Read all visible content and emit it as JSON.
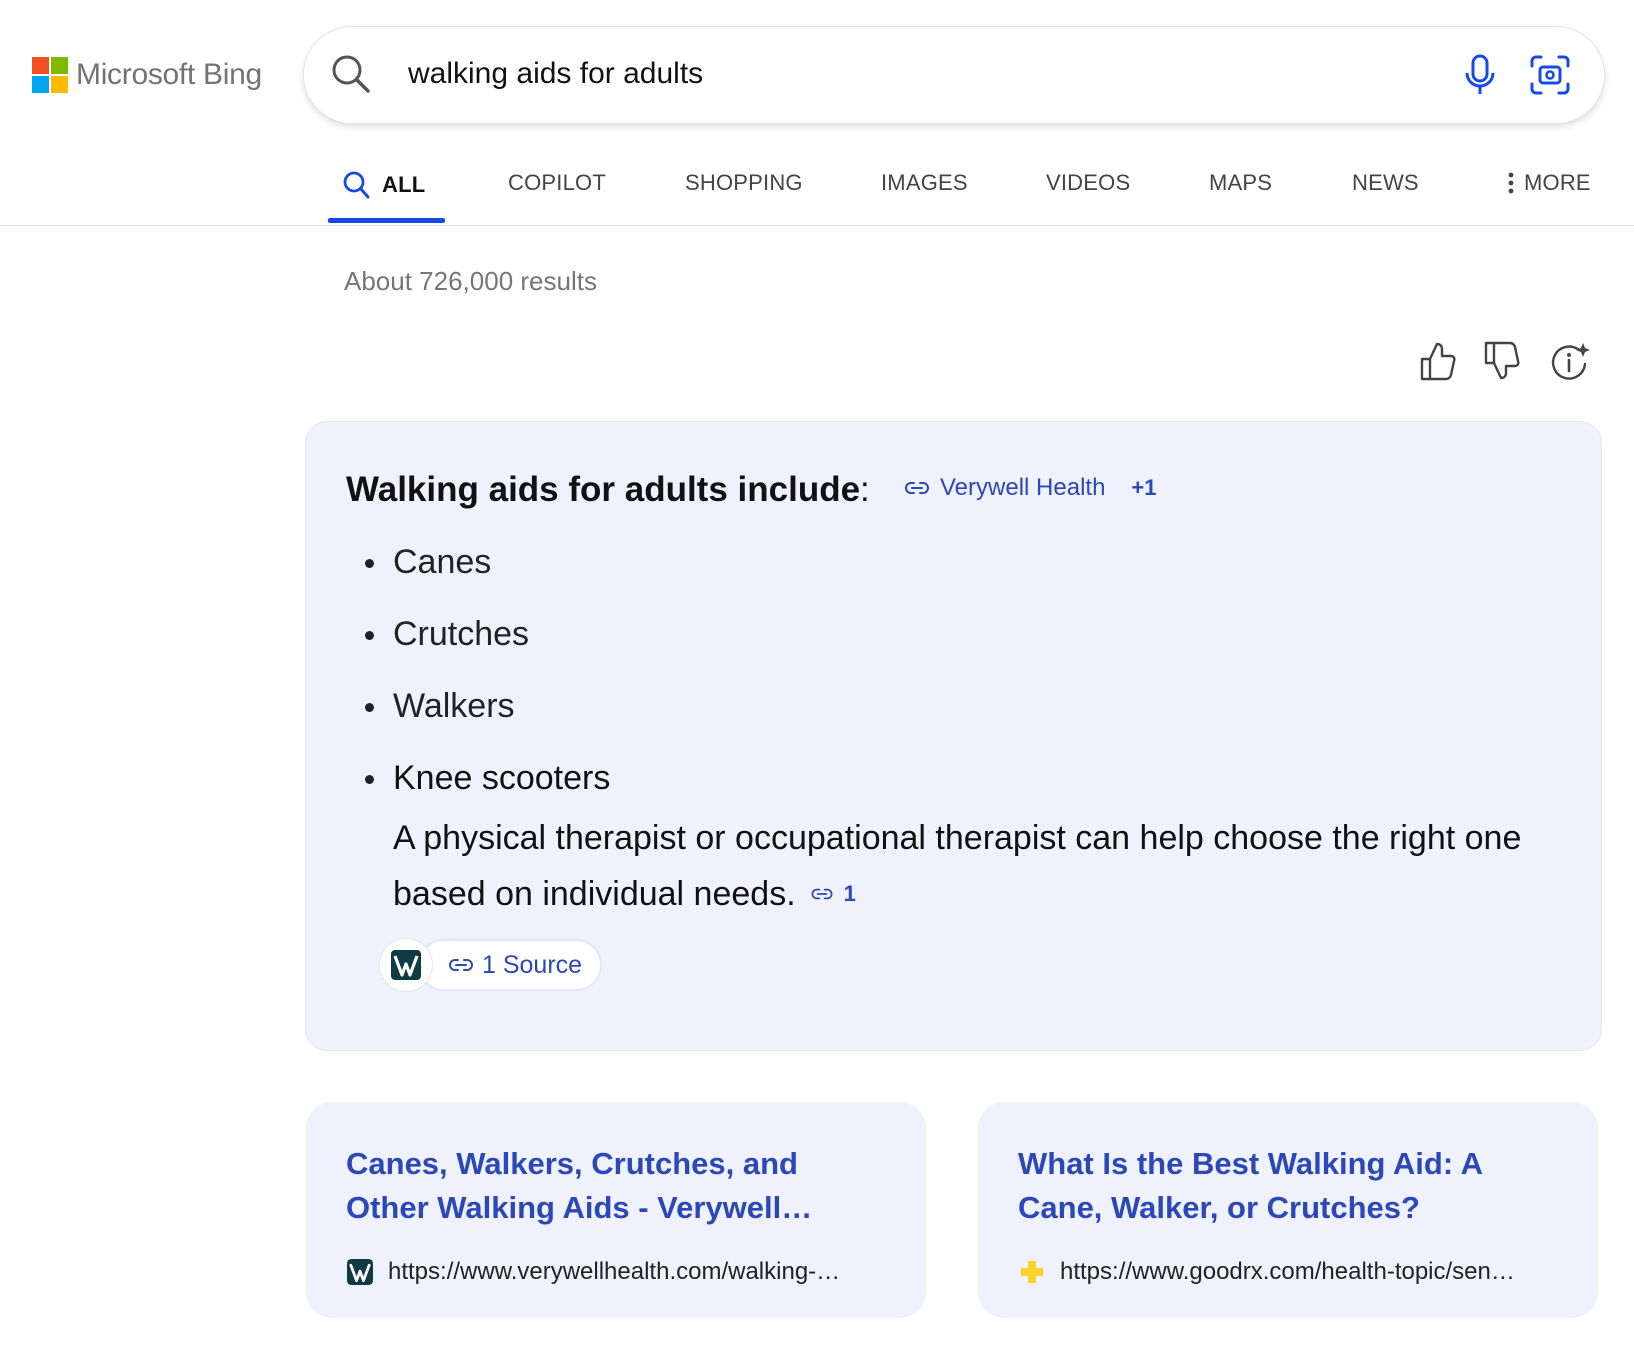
{
  "logo": {
    "text": "Microsoft Bing",
    "colors": [
      "#f25022",
      "#7fba00",
      "#00a4ef",
      "#ffb900"
    ]
  },
  "search": {
    "query": "walking aids for adults",
    "icons": [
      "search-icon",
      "microphone-icon",
      "visual-search-icon"
    ]
  },
  "tabs": [
    {
      "label": "ALL",
      "active": true,
      "icon": "search-icon"
    },
    {
      "label": "COPILOT"
    },
    {
      "label": "SHOPPING"
    },
    {
      "label": "IMAGES"
    },
    {
      "label": "VIDEOS"
    },
    {
      "label": "MAPS"
    },
    {
      "label": "NEWS"
    },
    {
      "label": "MORE",
      "icon": "more-vertical-icon"
    }
  ],
  "results_count": "About 726,000 results",
  "feedback_icons": [
    "thumbs-up-icon",
    "thumbs-down-icon",
    "info-sparkle-icon"
  ],
  "answer": {
    "heading": "Walking aids for adults include",
    "colon": ":",
    "citation": {
      "source": "Verywell Health",
      "more": "+1"
    },
    "items": [
      "Canes",
      "Crutches",
      "Walkers",
      "Knee scooters"
    ],
    "paragraph": "A physical therapist or occupational therapist can help choose the right one based on individual needs.",
    "paragraph_citation": "1",
    "sources_label": "1 Source"
  },
  "results": [
    {
      "title": "Canes, Walkers, Crutches, and Other Walking Aids - Verywell…",
      "url": "https://www.verywellhealth.com/walking-…",
      "favicon": "verywell-favicon"
    },
    {
      "title": "What Is the Best Walking Aid: A Cane, Walker, or Crutches?",
      "url": "https://www.goodrx.com/health-topic/sen…",
      "favicon": "goodrx-favicon"
    }
  ],
  "colors": {
    "accent": "#174ae4",
    "link": "#2c47b8",
    "card_bg": "#eff2fd"
  }
}
